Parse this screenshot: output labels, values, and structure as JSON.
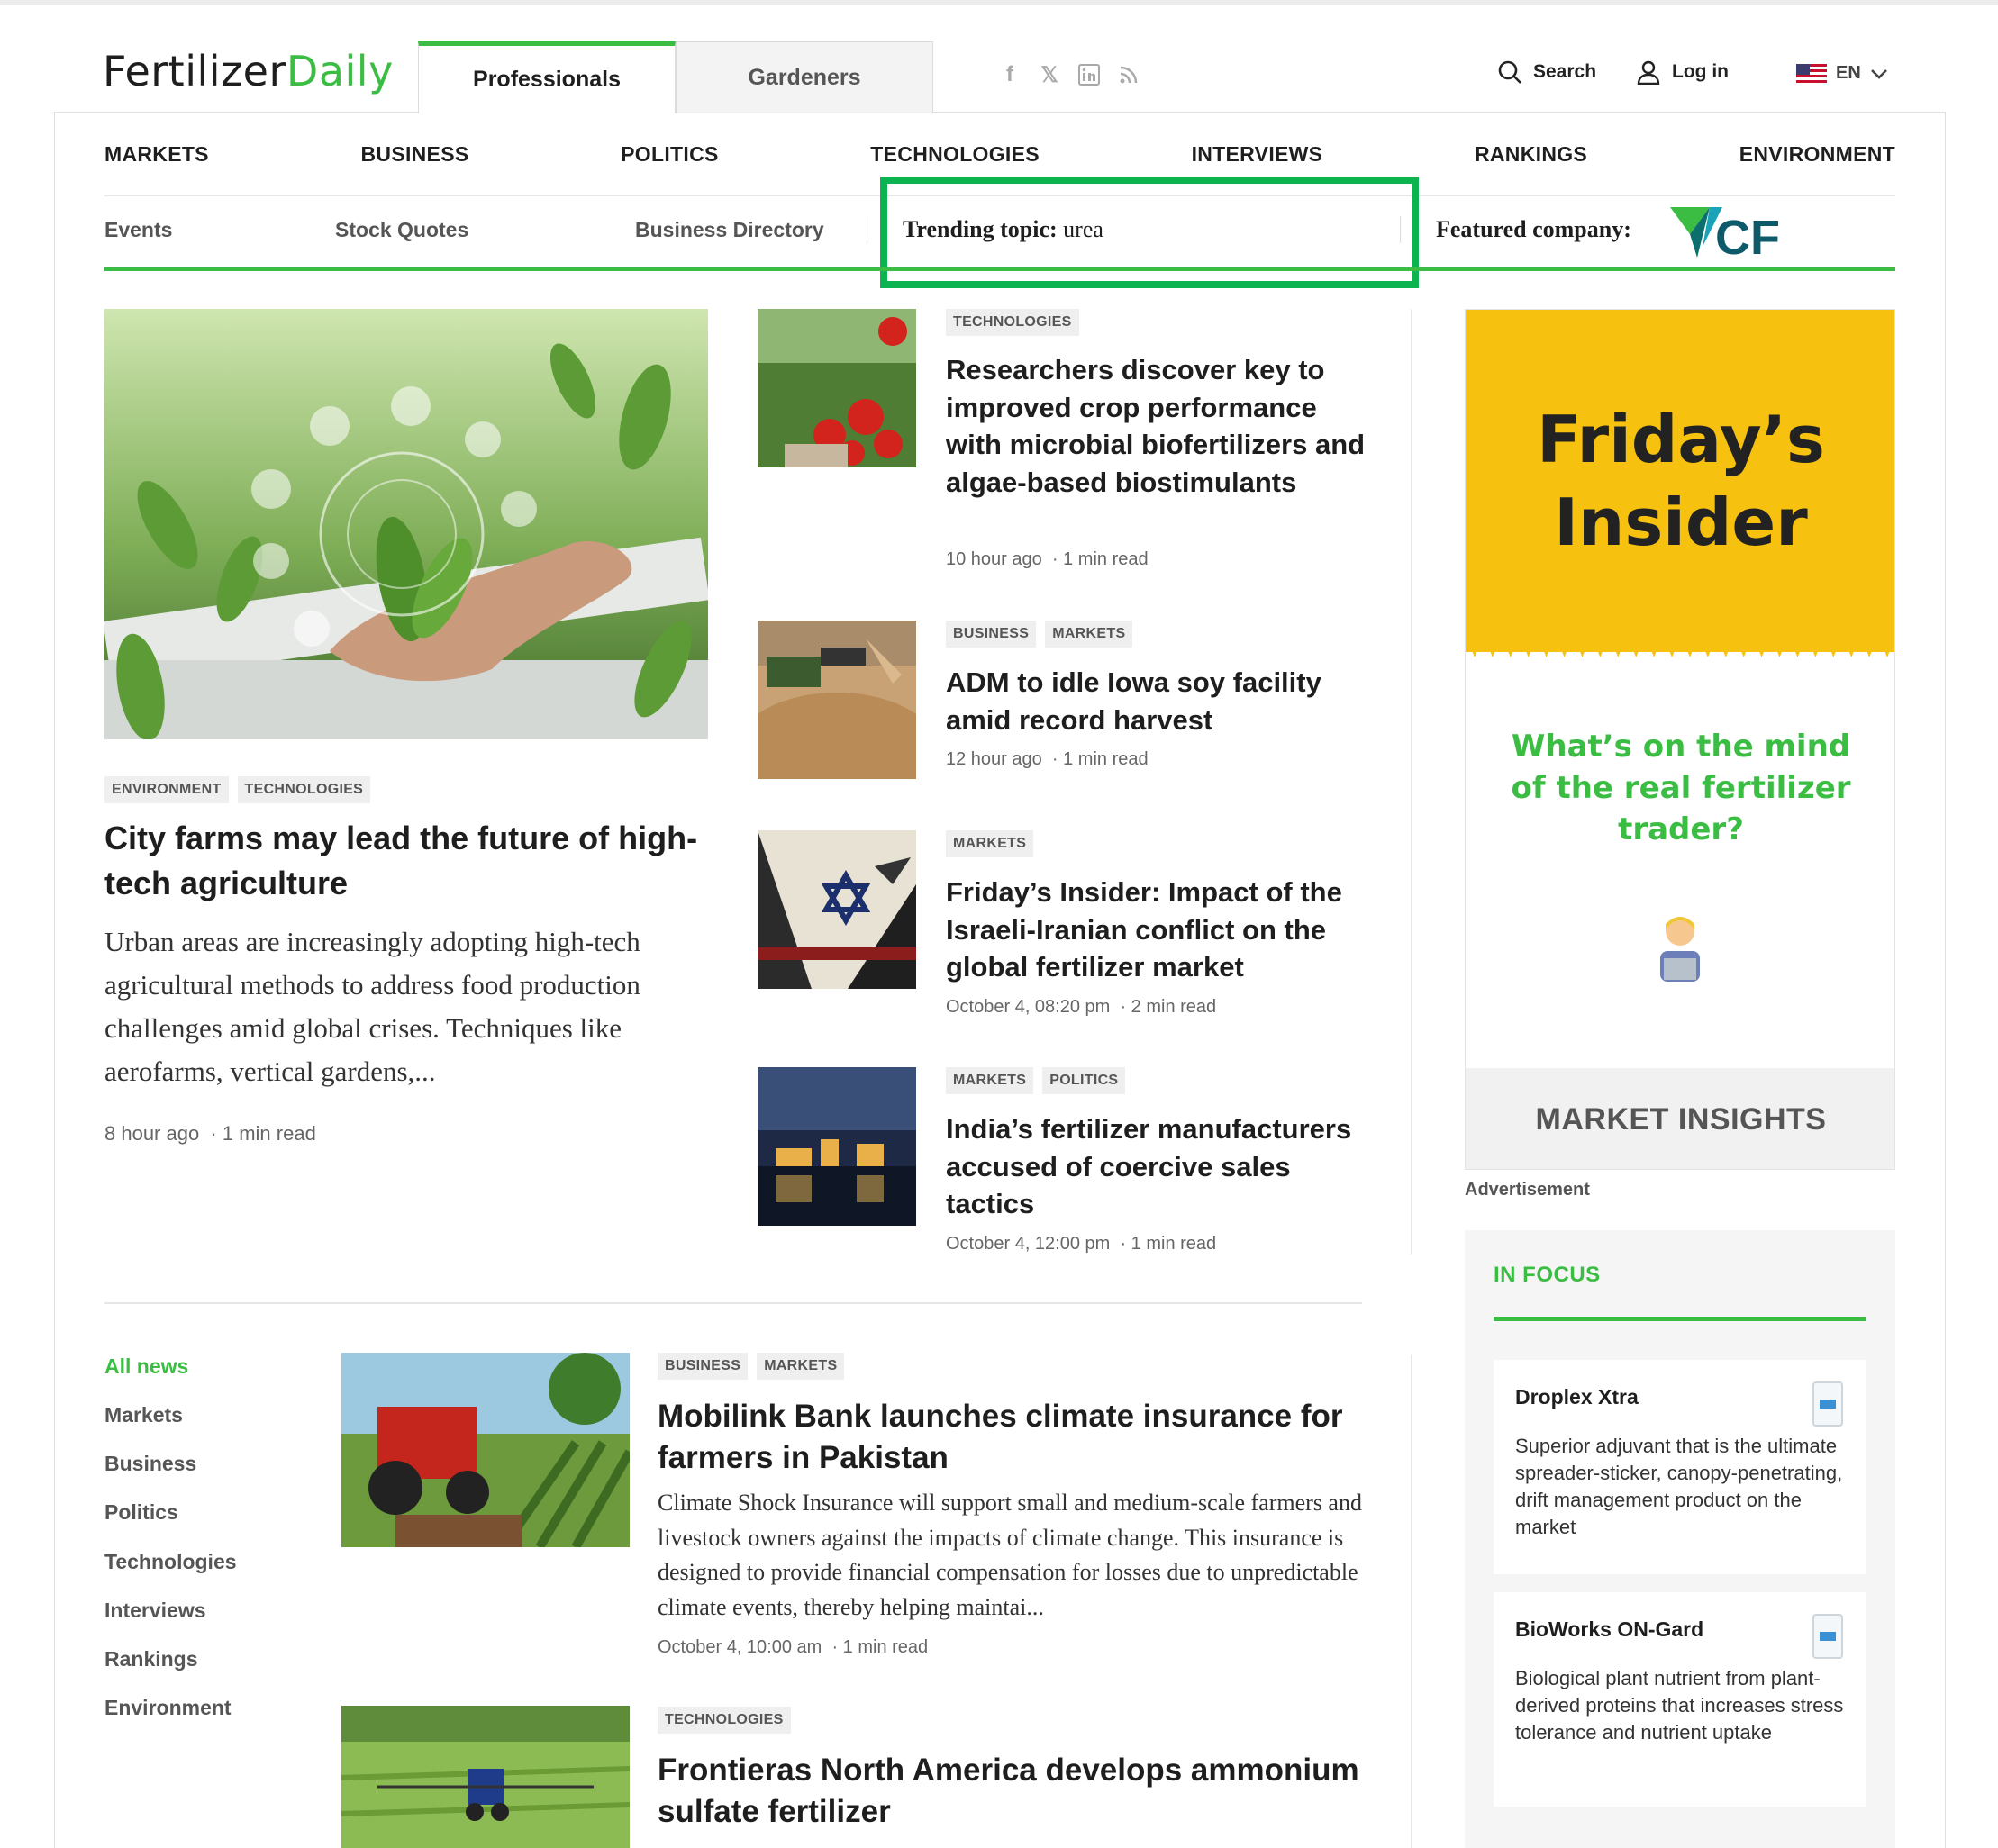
{
  "header": {
    "logo_part1": "Fertilizer",
    "logo_part2": "Daily",
    "audience_tabs": [
      "Professionals",
      "Gardeners"
    ],
    "social_icons": [
      "facebook-icon",
      "x-icon",
      "linkedin-icon",
      "rss-icon"
    ],
    "search_label": "Search",
    "login_label": "Log in",
    "language": "EN"
  },
  "main_nav": [
    "MARKETS",
    "BUSINESS",
    "POLITICS",
    "TECHNOLOGIES",
    "INTERVIEWS",
    "RANKINGS",
    "ENVIRONMENT"
  ],
  "sub_nav": {
    "events": "Events",
    "stock_quotes": "Stock Quotes",
    "business_directory": "Business Directory",
    "trending_label": "Trending topic:",
    "trending_value": "urea",
    "featured_label": "Featured company:",
    "featured_company_logo_text": "CF"
  },
  "hero": {
    "tags": [
      "ENVIRONMENT",
      "TECHNOLOGIES"
    ],
    "title": "City farms may lead the future of high-tech agriculture",
    "description": "Urban areas are increasingly adopting high-tech agricultural methods to address food production challenges amid global crises. Techniques like aerofarms, vertical gardens,...",
    "time": "8 hour ago",
    "read": "1 min read"
  },
  "middle_articles": [
    {
      "tags": [
        "TECHNOLOGIES"
      ],
      "title": "Researchers discover key to improved crop performance with microbial biofertilizers and algae-based biostimulants",
      "time": "10 hour ago",
      "read": "1 min read"
    },
    {
      "tags": [
        "BUSINESS",
        "MARKETS"
      ],
      "title": "ADM to idle Iowa soy facility amid record harvest",
      "time": "12 hour ago",
      "read": "1 min read"
    },
    {
      "tags": [
        "MARKETS"
      ],
      "title": "Friday’s Insider: Impact of the Israeli-Iranian conflict on the global fertilizer market",
      "time": "October 4, 08:20 pm",
      "read": "2 min read"
    },
    {
      "tags": [
        "MARKETS",
        "POLITICS"
      ],
      "title": "India’s fertilizer manufacturers accused of coercive sales tactics",
      "time": "October 4, 12:00 pm",
      "read": "1 min read"
    }
  ],
  "ad": {
    "title_line1": "Friday’s",
    "title_line2": "Insider",
    "question": "What’s on the mind of the real fertilizer trader?",
    "bottom": "MARKET INSIGHTS",
    "label": "Advertisement"
  },
  "in_focus": {
    "title": "IN FOCUS",
    "items": [
      {
        "name": "Droplex Xtra",
        "desc": "Superior adjuvant that is the ultimate spreader-sticker, canopy-penetrating, drift management product on the market"
      },
      {
        "name": "BioWorks ON-Gard",
        "desc": "Biological plant nutrient from plant-derived proteins that increases stress tolerance and nutrient uptake"
      }
    ]
  },
  "category_list": [
    "All news",
    "Markets",
    "Business",
    "Politics",
    "Technologies",
    "Interviews",
    "Rankings",
    "Environment"
  ],
  "bottom_articles": [
    {
      "tags": [
        "BUSINESS",
        "MARKETS"
      ],
      "title": "Mobilink Bank launches climate insurance for farmers in Pakistan",
      "description": "Climate Shock Insurance will support small and medium-scale farmers and livestock owners against the impacts of climate change. This insurance is designed to provide financial compensation for losses due to unpredictable climate events, thereby helping maintai...",
      "time": "October 4, 10:00 am",
      "read": "1 min read"
    },
    {
      "tags": [
        "TECHNOLOGIES"
      ],
      "title": "Frontieras North America develops ammonium sulfate fertilizer"
    }
  ],
  "colors": {
    "brand_green": "#3bbd44",
    "highlight_green": "#0cb350",
    "ad_yellow": "#f7c10f"
  }
}
